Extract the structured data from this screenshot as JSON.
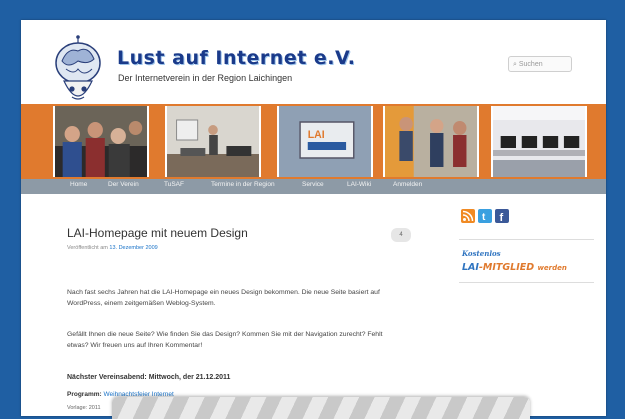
{
  "site": {
    "title": "Lust auf Internet e.V.",
    "description": "Der Internetverein in der Region Laichingen"
  },
  "search": {
    "placeholder": "Suchen"
  },
  "nav": {
    "items": [
      {
        "label": "Home"
      },
      {
        "label": "Der Verein"
      },
      {
        "label": "TuSAF"
      },
      {
        "label": "Termine in der Region"
      },
      {
        "label": "Service"
      },
      {
        "label": "LAI-Wiki"
      },
      {
        "label": "Anmelden"
      }
    ]
  },
  "post": {
    "title": "LAI-Homepage mit neuem Design",
    "meta_prefix": "Veröffentlicht am",
    "meta_date": "13. Dezember 2009",
    "comment_count": "4",
    "para1": "Nach fast sechs Jahren hat die LAI-Homepage ein neues Design bekommen. Die neue Seite basiert auf WordPress, einem zeitgemäßen Weblog-System.",
    "para2": "Gefällt Ihnen die neue Seite? Wie finden Sie das Design? Kommen Sie mit der Navigation zurecht? Fehlt etwas? Wir freuen uns auf Ihren Kommentar!",
    "next_meeting": "Nächster Vereinsabend: Mittwoch, der 21.12.2011",
    "program_label": "Programm:",
    "program_value": "Weihnachtsfeier Internet",
    "small_line": "Vorlage: 2011"
  },
  "sidebar": {
    "social": [
      {
        "name": "rss-icon",
        "color": "#f08a24"
      },
      {
        "name": "twitter-icon",
        "color": "#3aa0e0"
      },
      {
        "name": "facebook-icon",
        "color": "#3b5998"
      }
    ],
    "kostenlos": "Kostenlos",
    "mitglied_lai": "LAI",
    "mitglied_main": "-MITGLIED",
    "mitglied_werden": "werden"
  },
  "colors": {
    "brand_blue": "#1f5fa3",
    "banner_orange": "#e07a2e",
    "nav_gray": "#8d9aa6"
  }
}
